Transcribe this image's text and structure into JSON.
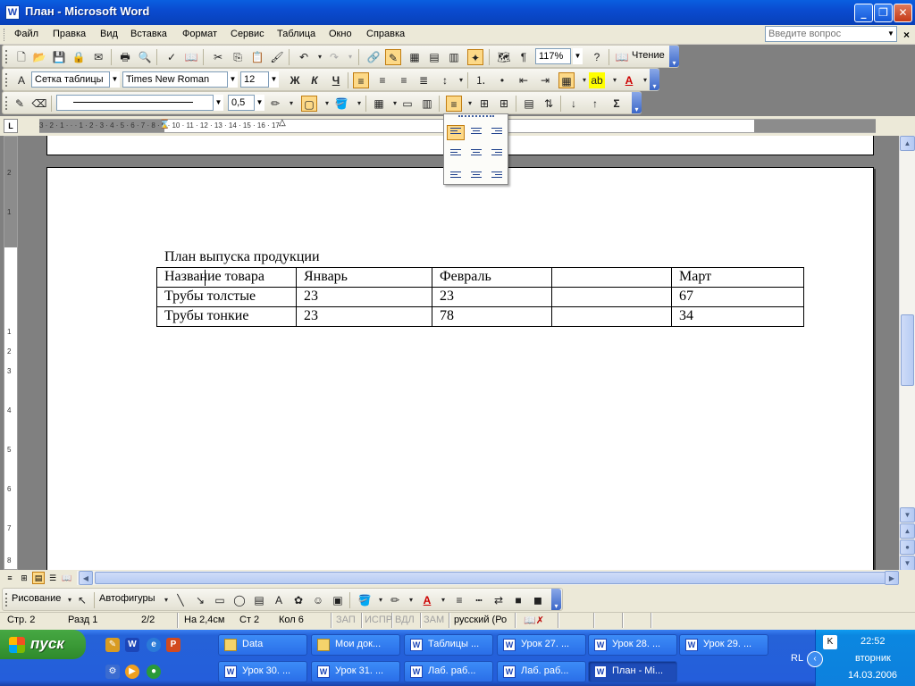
{
  "window": {
    "title": "План - Microsoft Word",
    "icon_letter": "W"
  },
  "window_controls": {
    "minimize": "_",
    "maximize": "❐",
    "close": "✕"
  },
  "menu": {
    "items": [
      "Файл",
      "Правка",
      "Вид",
      "Вставка",
      "Формат",
      "Сервис",
      "Таблица",
      "Окно",
      "Справка"
    ],
    "ask_placeholder": "Введите вопрос"
  },
  "standard_toolbar": {
    "zoom": "117%",
    "reading_label": "Чтение"
  },
  "format_toolbar": {
    "style": "Сетка таблицы",
    "font": "Times New Roman",
    "size": "12",
    "bold": "Ж",
    "italic": "К",
    "underline": "Ч"
  },
  "tables_toolbar": {
    "line_weight": "0,5",
    "sigma": "Σ"
  },
  "ruler": {
    "ticks": "3 · 2 · 1 · · · 1 · 2 · 3 · 4 · 5 · 6 · 7 · 8 · 9 · 10 · 11 · 12 · 13 · 14 · 15 · 16 · 17 ·",
    "corner": "L"
  },
  "vruler": {
    "labels": [
      "2",
      "1",
      "1",
      "2",
      "3",
      "4",
      "5",
      "6",
      "7",
      "8"
    ]
  },
  "document": {
    "title": "План выпуска продукции",
    "table": {
      "rows": [
        [
          "Название товара",
          "Январь",
          "Февраль",
          "",
          "Март"
        ],
        [
          "Трубы толстые",
          "23",
          "23",
          "",
          "67"
        ],
        [
          "Трубы тонкие",
          "23",
          "78",
          "",
          "34"
        ]
      ]
    }
  },
  "drawing_toolbar": {
    "draw_label": "Рисование",
    "autoshapes_label": "Автофигуры"
  },
  "statusbar": {
    "page": "Стр. 2",
    "section": "Разд 1",
    "pages": "2/2",
    "at": "На 2,4см",
    "line": "Ст 2",
    "col": "Кол 6",
    "rec": "ЗАП",
    "trk": "ИСПР",
    "ext": "ВДЛ",
    "ovr": "ЗАМ",
    "language": "русский (Ро"
  },
  "taskbar": {
    "start_label": "пуск",
    "row1": [
      "Data",
      "Мои док...",
      "Таблицы ...",
      "Урок 27. ...",
      "Урок 28. ...",
      "Урок 29. ..."
    ],
    "row2": [
      "Урок 30. ...",
      "Урок 31. ...",
      "Лаб. раб...",
      "Лаб. раб...",
      "План - Mi..."
    ],
    "lang": "RL",
    "time": "22:52",
    "day": "вторник",
    "date": "14.03.2006"
  },
  "colors": {
    "titlebar": "#0a4bd0",
    "taskbar": "#245edb",
    "start": "#3b9a37",
    "toolbar_bg": "#ece9d8",
    "highlight": "#fdd987"
  }
}
